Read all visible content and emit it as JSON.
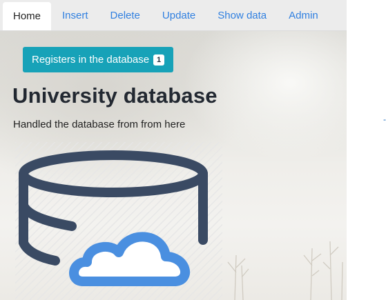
{
  "nav": {
    "items": [
      {
        "label": "Home",
        "active": true
      },
      {
        "label": "Insert",
        "active": false
      },
      {
        "label": "Delete",
        "active": false
      },
      {
        "label": "Update",
        "active": false
      },
      {
        "label": "Show data",
        "active": false
      },
      {
        "label": "Admin",
        "active": false
      }
    ]
  },
  "registers_button": {
    "label": "Registers in the database",
    "count": "1"
  },
  "header": {
    "title": "University database",
    "subtitle": "Handled the database from from here"
  },
  "illustration": {
    "icon": "database-cloud-icon",
    "db_color": "#3a4a63",
    "cloud_color": "#4a8fe0"
  },
  "side_mark": {
    "glyph": "-"
  },
  "colors": {
    "accent": "#17a2b8",
    "link": "#2f7fe0"
  }
}
